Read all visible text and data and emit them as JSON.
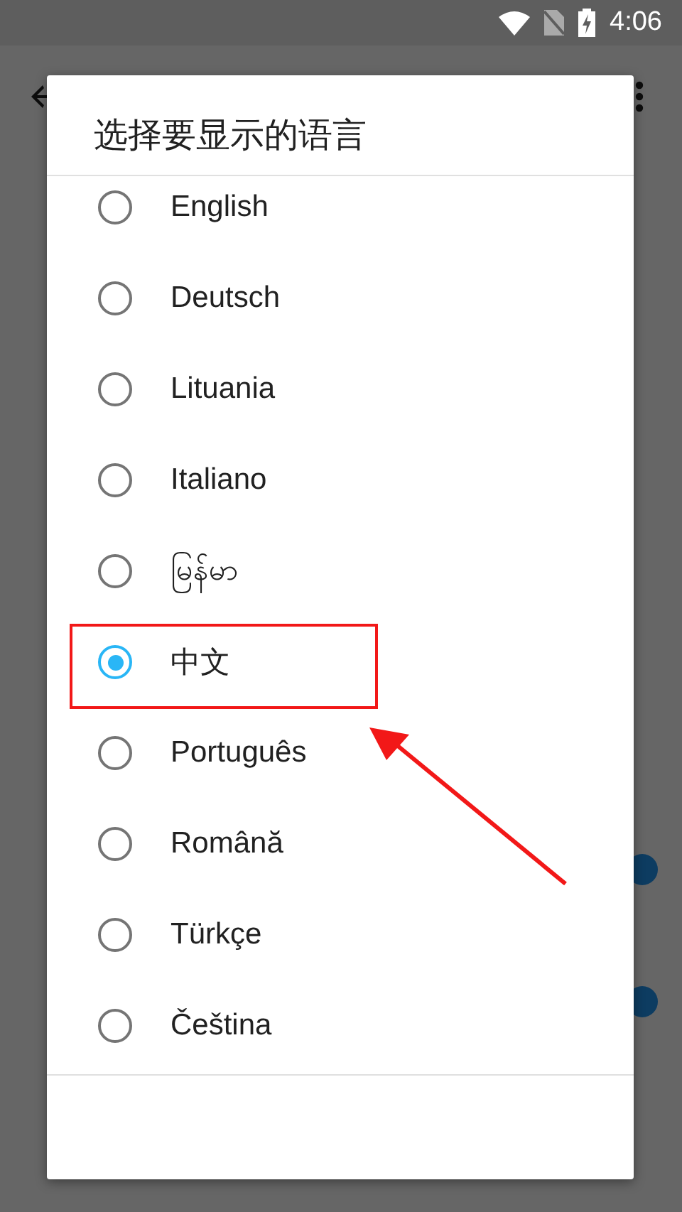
{
  "status_bar": {
    "time": "4:06"
  },
  "background": {
    "switches": [
      {
        "on": true
      },
      {
        "on": true
      }
    ]
  },
  "dialog": {
    "title": "选择要显示的语言",
    "options": [
      {
        "label": "English",
        "selected": false
      },
      {
        "label": "Deutsch",
        "selected": false
      },
      {
        "label": "Lituania",
        "selected": false
      },
      {
        "label": "Italiano",
        "selected": false
      },
      {
        "label": "မြန်မာ",
        "selected": false
      },
      {
        "label": "中文",
        "selected": true
      },
      {
        "label": "Português",
        "selected": false
      },
      {
        "label": "Română",
        "selected": false
      },
      {
        "label": "Türkçe",
        "selected": false
      },
      {
        "label": "Čeština",
        "selected": false
      }
    ]
  }
}
